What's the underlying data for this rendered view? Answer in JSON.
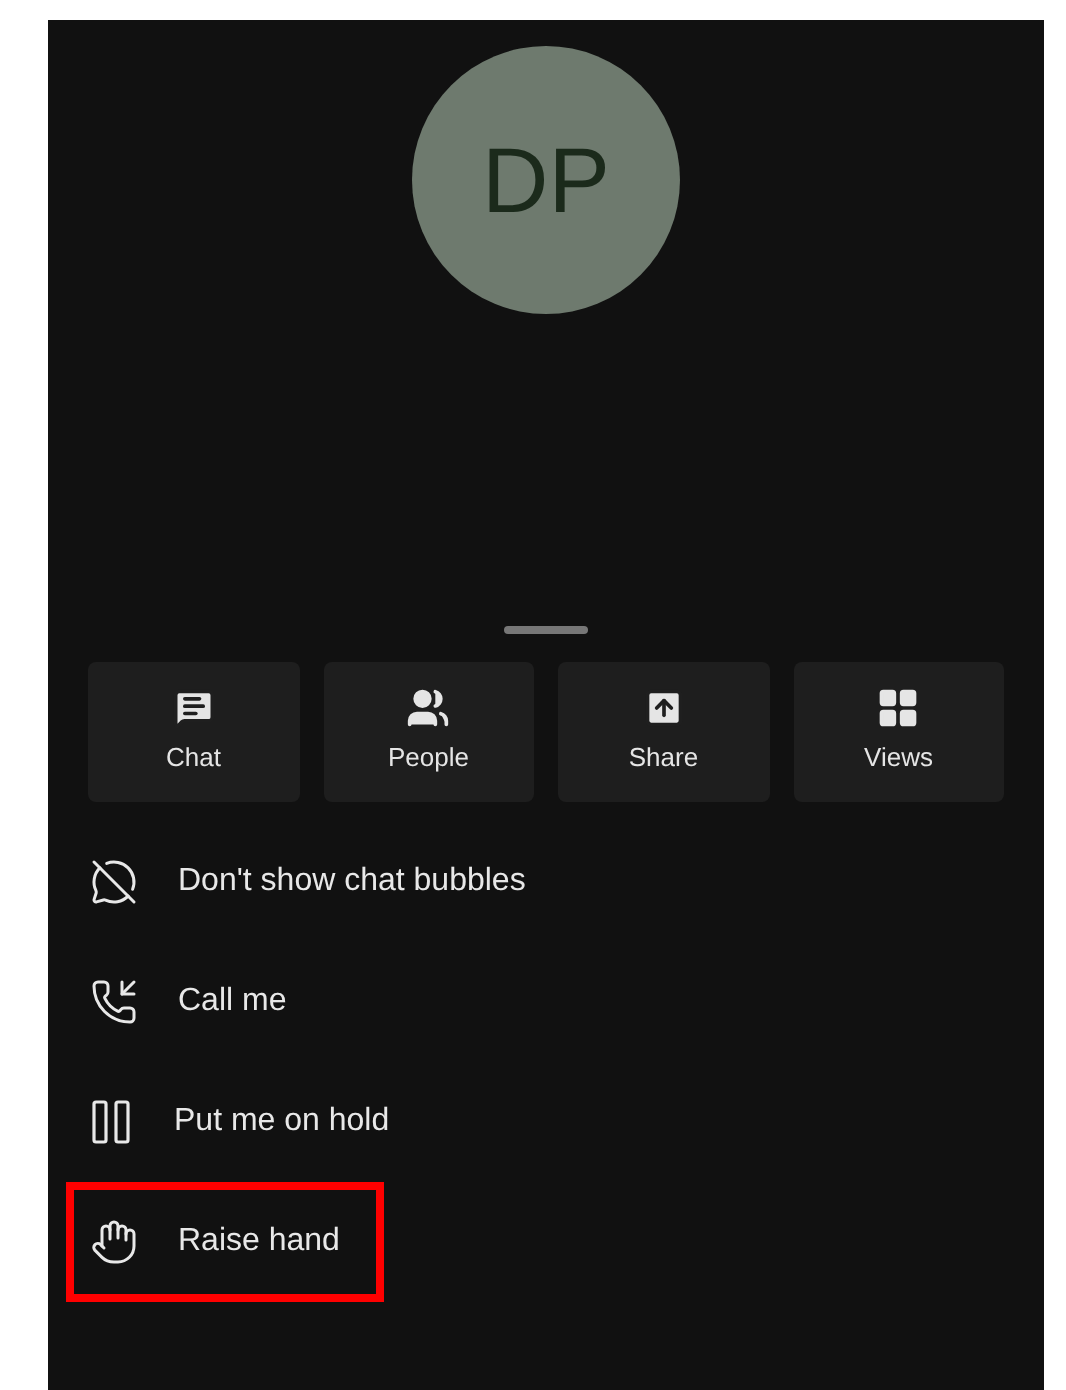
{
  "avatar": {
    "initials": "DP"
  },
  "actions": [
    {
      "kind": "chat",
      "label": "Chat"
    },
    {
      "kind": "people",
      "label": "People"
    },
    {
      "kind": "share",
      "label": "Share"
    },
    {
      "kind": "views",
      "label": "Views"
    }
  ],
  "menu": [
    {
      "kind": "bubbles",
      "label": "Don't show chat bubbles",
      "highlighted": false
    },
    {
      "kind": "callme",
      "label": "Call me",
      "highlighted": false
    },
    {
      "kind": "hold",
      "label": "Put me on hold",
      "highlighted": false
    },
    {
      "kind": "hand",
      "label": "Raise hand",
      "highlighted": true
    }
  ]
}
